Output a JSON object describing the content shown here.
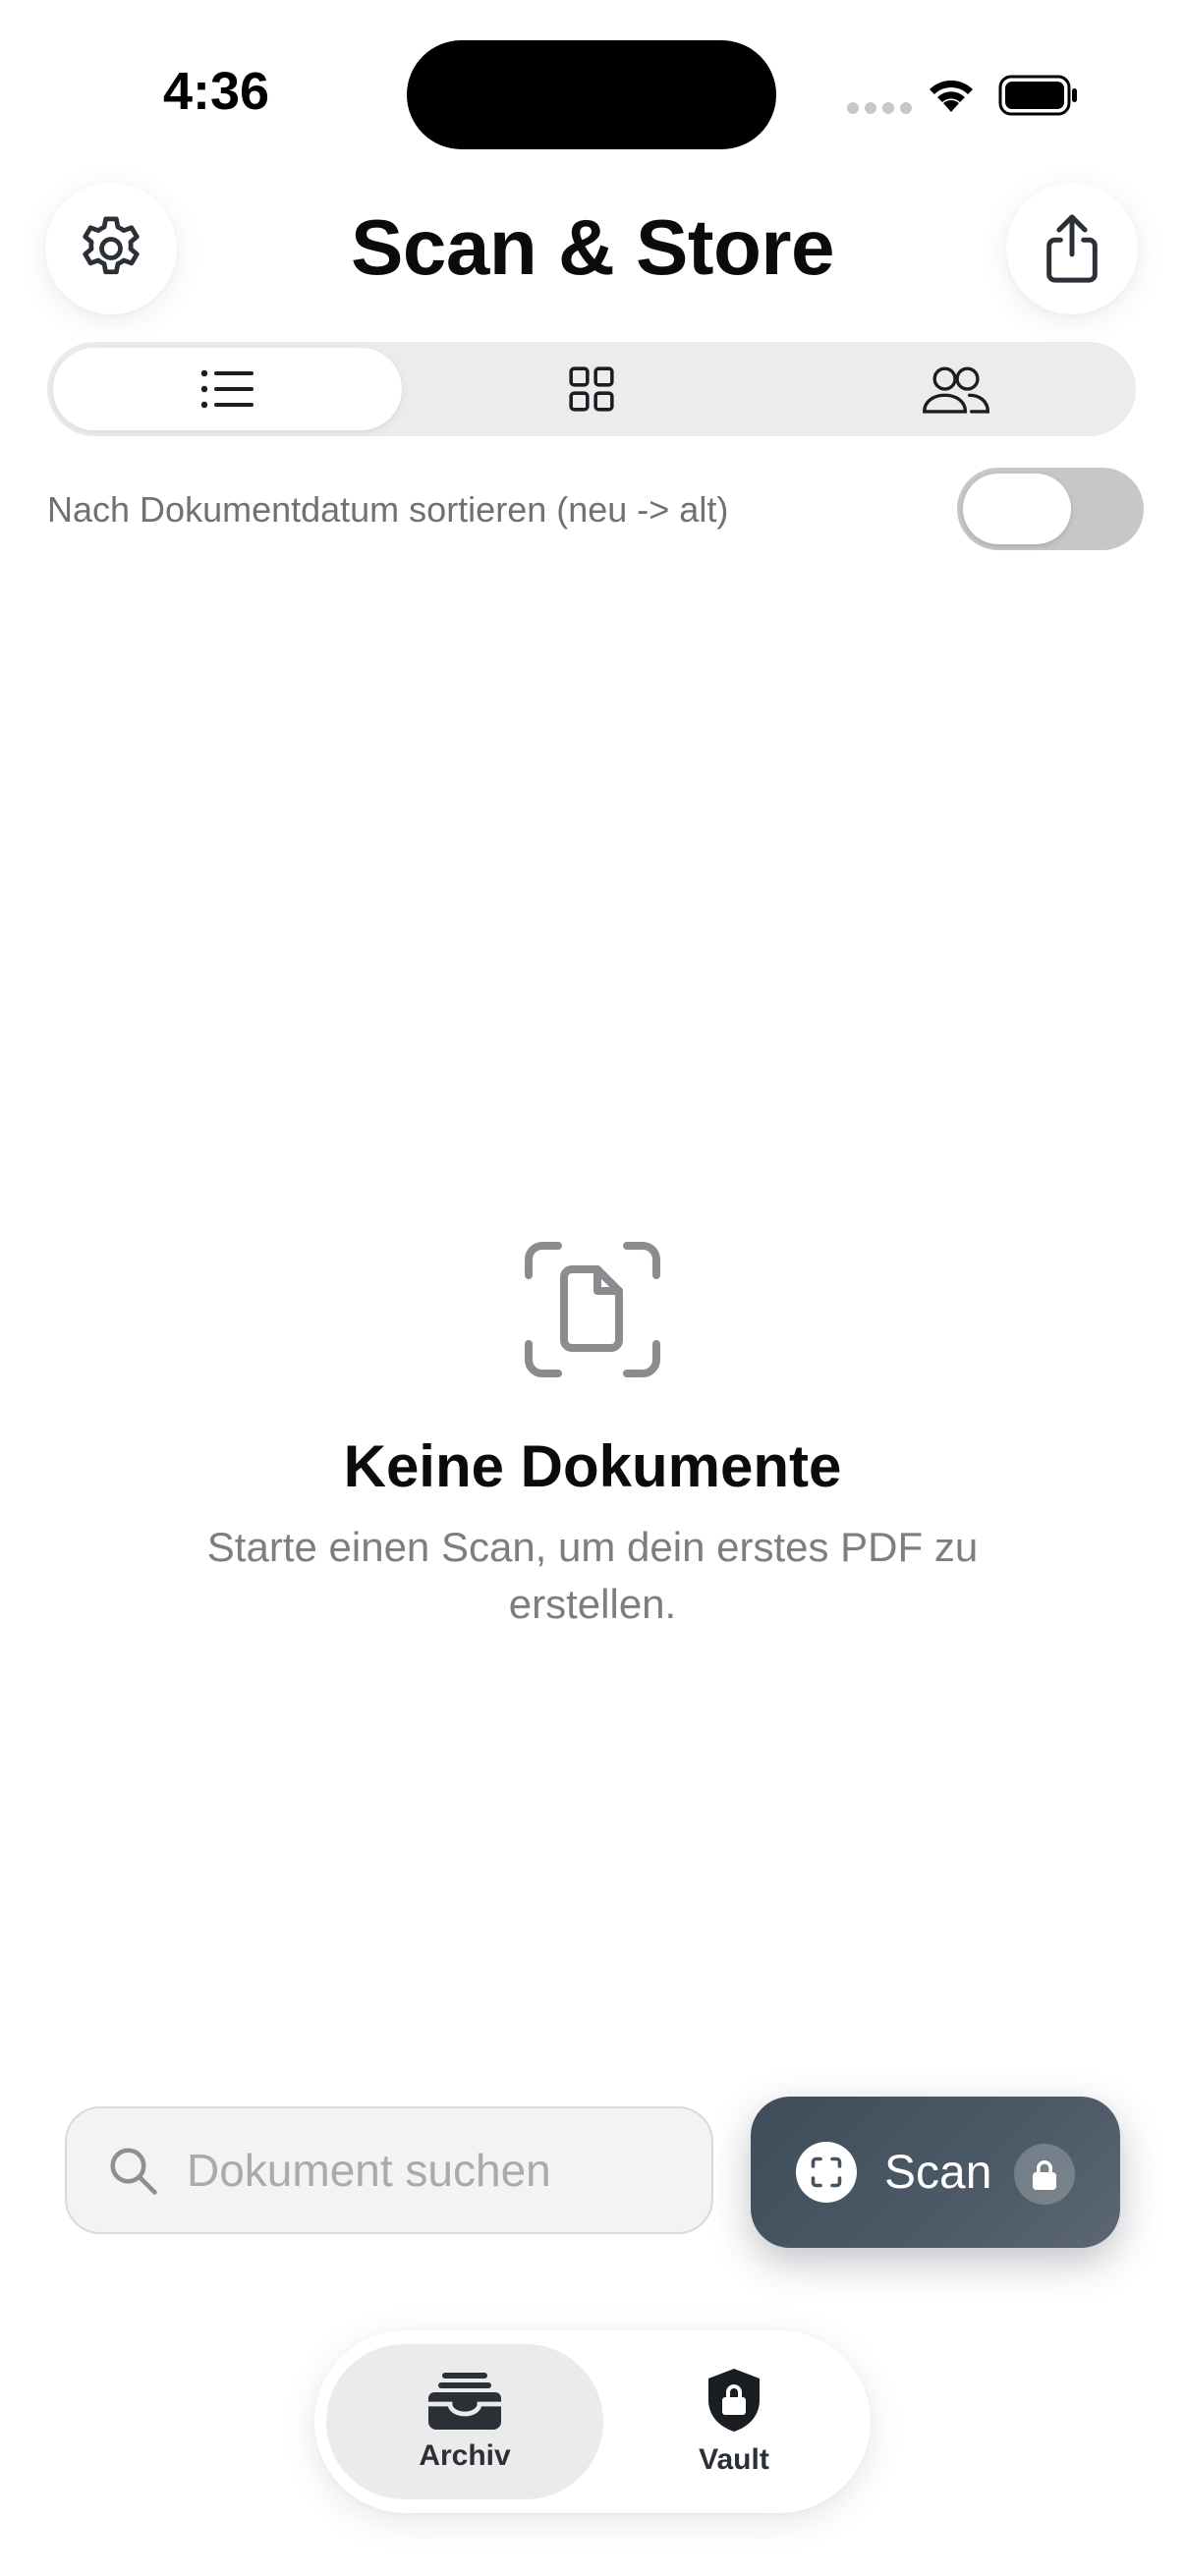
{
  "status_bar": {
    "time": "4:36"
  },
  "header": {
    "title": "Scan & Store",
    "settings_icon": "gear-icon",
    "share_icon": "share-icon"
  },
  "view_switcher": {
    "options": [
      {
        "icon": "list-icon",
        "selected": true
      },
      {
        "icon": "grid-icon",
        "selected": false
      },
      {
        "icon": "people-icon",
        "selected": false
      }
    ]
  },
  "sort": {
    "label": "Nach Dokumentdatum sortieren (neu -> alt)",
    "enabled": false
  },
  "empty_state": {
    "icon": "document-scan-icon",
    "title": "Keine Dokumente",
    "text": "Starte einen Scan, um dein erstes PDF zu erstellen."
  },
  "search": {
    "placeholder": "Dokument suchen",
    "value": ""
  },
  "scan_button": {
    "label": "Scan",
    "icon": "scan-frame-icon",
    "badge_icon": "lock-icon"
  },
  "tab_bar": {
    "tabs": [
      {
        "label": "Archiv",
        "icon": "tray-icon",
        "active": true
      },
      {
        "label": "Vault",
        "icon": "shield-lock-icon",
        "active": false
      }
    ]
  },
  "colors": {
    "scan_button_bg": "#46525f",
    "accent_dark": "#2b2f36",
    "muted_text": "#7d7d82"
  }
}
